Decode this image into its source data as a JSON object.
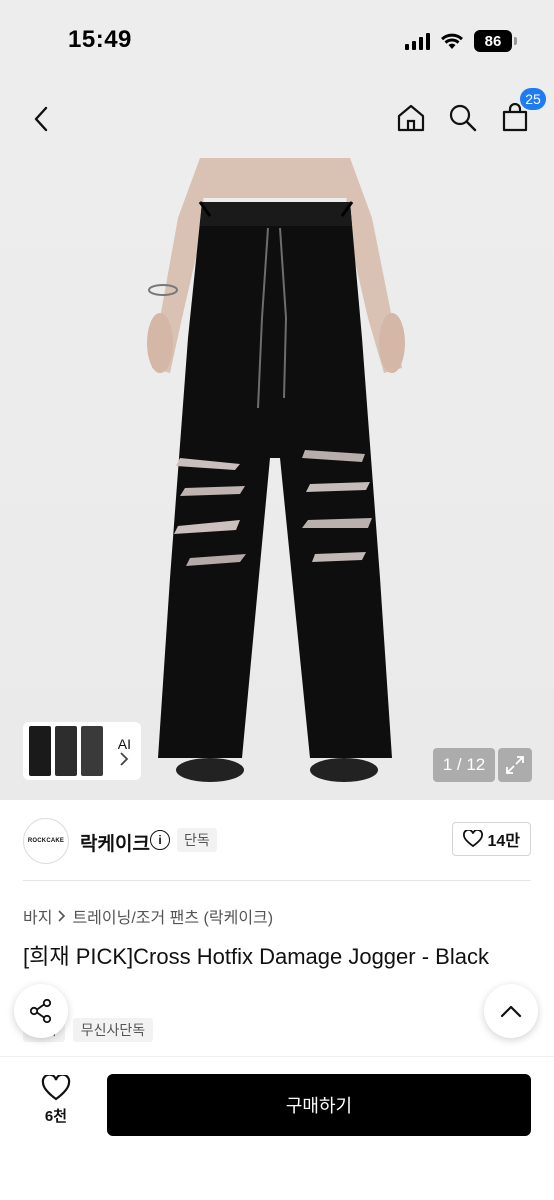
{
  "status_bar": {
    "time": "15:49",
    "battery": "86"
  },
  "header": {
    "back_icon": "chevron-left-icon",
    "icons": [
      "home-icon",
      "search-icon",
      "cart-icon"
    ],
    "cart_count": "25"
  },
  "gallery": {
    "ai_label": "AI",
    "page": "1 / 12"
  },
  "brand": {
    "logo_text": "ROCKCAKE",
    "name": "락케이크",
    "tag": "단독",
    "like_count": "14만"
  },
  "breadcrumb": {
    "category": "바지",
    "subcategory": "트레이닝/조거 팬츠 (락케이크)"
  },
  "product": {
    "title": "[희재 PICK]Cross Hotfix Damage Jogger - Black",
    "tags": [
      "기획",
      "무신사단독"
    ]
  },
  "bottom_bar": {
    "wish_count": "6천",
    "buy_label": "구매하기"
  },
  "colors": {
    "accent": "#1e7cf0",
    "button": "#000000",
    "background": "#ededed"
  }
}
